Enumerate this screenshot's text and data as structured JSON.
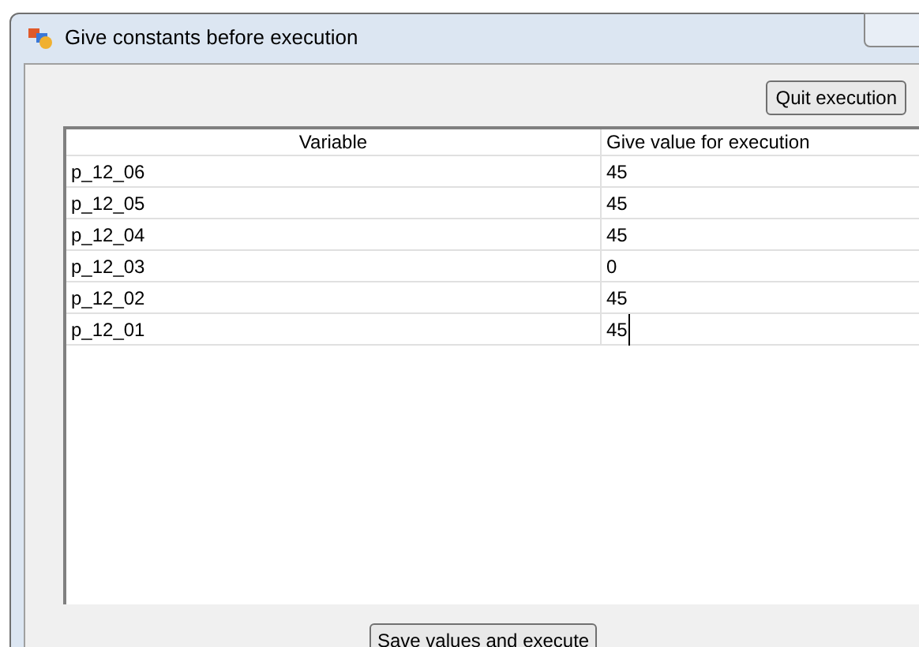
{
  "window": {
    "title": "Give constants before execution"
  },
  "quit_button": "Quit execution",
  "table": {
    "columns": [
      "Variable",
      "Give value for execution"
    ],
    "rows": [
      {
        "variable": "p_12_06",
        "value": "45",
        "editing": false
      },
      {
        "variable": "p_12_05",
        "value": "45",
        "editing": false
      },
      {
        "variable": "p_12_04",
        "value": "45",
        "editing": false
      },
      {
        "variable": "p_12_03",
        "value": "0",
        "editing": false
      },
      {
        "variable": "p_12_02",
        "value": "45",
        "editing": false
      },
      {
        "variable": "p_12_01",
        "value": "45",
        "editing": true
      }
    ]
  },
  "save_button": "Save values and execute"
}
